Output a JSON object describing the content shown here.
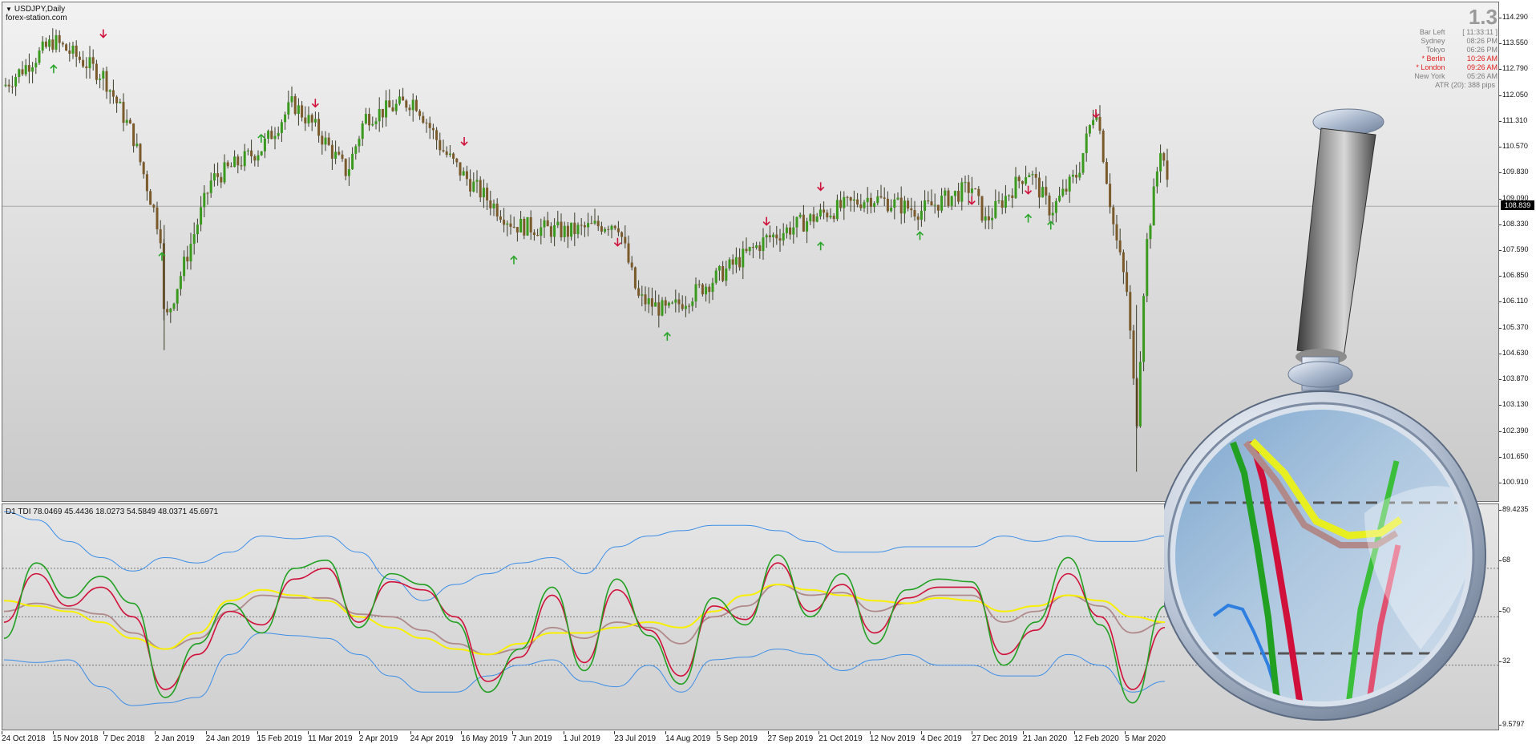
{
  "window": {
    "symbol": "USDJPY,Daily",
    "watermark": "forex-station.com",
    "indicator_title": "D1 TDI 78.0469 45.4436 18.0273 54.5849 48.0371 45.6971"
  },
  "info_panel": {
    "big_value": "1.3",
    "rows": [
      {
        "label": "Bar Left",
        "value": "[ 11:33:11 ]",
        "highlight": false
      },
      {
        "label": "Sydney",
        "value": "08:26 PM",
        "highlight": false
      },
      {
        "label": "Tokyo",
        "value": "06:26 PM",
        "highlight": false
      },
      {
        "label": "* Berlin",
        "value": "10:26 AM",
        "highlight": true
      },
      {
        "label": "* London",
        "value": "09:26 AM",
        "highlight": true
      },
      {
        "label": "New York",
        "value": "05:26 AM",
        "highlight": false
      },
      {
        "label": "ATR (20): 388 pips",
        "value": "",
        "highlight": false
      }
    ]
  },
  "price_axis": {
    "ticks": [
      "114.290",
      "113.550",
      "112.790",
      "112.050",
      "111.310",
      "110.570",
      "109.830",
      "109.090",
      "108.330",
      "107.590",
      "106.850",
      "106.110",
      "105.370",
      "104.630",
      "103.870",
      "103.130",
      "102.390",
      "101.650",
      "100.910"
    ],
    "current_price": "108.839",
    "current_value": 108.839
  },
  "indicator_axis": {
    "ticks": [
      "89.4235",
      "68",
      "50",
      "32",
      "9.5797"
    ]
  },
  "time_axis": {
    "labels": [
      "24 Oct 2018",
      "15 Nov 2018",
      "7 Dec 2018",
      "2 Jan 2019",
      "24 Jan 2019",
      "15 Feb 2019",
      "11 Mar 2019",
      "2 Apr 2019",
      "24 Apr 2019",
      "16 May 2019",
      "7 Jun 2019",
      "1 Jul 2019",
      "23 Jul 2019",
      "14 Aug 2019",
      "5 Sep 2019",
      "27 Sep 2019",
      "21 Oct 2019",
      "12 Nov 2019",
      "4 Dec 2019",
      "27 Dec 2019",
      "21 Jan 2020",
      "12 Feb 2020",
      "5 Mar 2020"
    ]
  },
  "colors": {
    "bull": "#3a9a1e",
    "bear": "#7a5a2a",
    "up_arrow": "#2aa52a",
    "down_arrow": "#d0103a",
    "rsi_green": "#22a022",
    "signal_red": "#d0103a",
    "market_base": "#f7f000",
    "mid_band": "#b08a8a",
    "vol_band": "#3d8ee8"
  },
  "chart_data": [
    {
      "type": "candlestick",
      "symbol": "USDJPY",
      "timeframe": "Daily",
      "ylim": [
        100.91,
        114.29
      ],
      "close_path": [
        [
          "24 Oct 2018",
          112.3
        ],
        [
          "15 Nov 2018",
          113.6
        ],
        [
          "7 Dec 2018",
          112.6
        ],
        [
          "20 Dec 2018",
          110.9
        ],
        [
          "2 Jan 2019",
          107.9
        ],
        [
          "3 Jan 2019",
          105.4
        ],
        [
          "24 Jan 2019",
          109.6
        ],
        [
          "15 Feb 2019",
          110.5
        ],
        [
          "1 Mar 2019",
          111.8
        ],
        [
          "11 Mar 2019",
          111.1
        ],
        [
          "25 Mar 2019",
          109.8
        ],
        [
          "2 Apr 2019",
          111.4
        ],
        [
          "24 Apr 2019",
          111.9
        ],
        [
          "6 May 2019",
          110.5
        ],
        [
          "16 May 2019",
          109.7
        ],
        [
          "7 Jun 2019",
          108.3
        ],
        [
          "1 Jul 2019",
          108.1
        ],
        [
          "23 Jul 2019",
          108.4
        ],
        [
          "1 Aug 2019",
          106.2
        ],
        [
          "14 Aug 2019",
          105.8
        ],
        [
          "5 Sep 2019",
          106.8
        ],
        [
          "27 Sep 2019",
          107.9
        ],
        [
          "21 Oct 2019",
          108.6
        ],
        [
          "12 Nov 2019",
          109.1
        ],
        [
          "4 Dec 2019",
          108.7
        ],
        [
          "27 Dec 2019",
          109.4
        ],
        [
          "2 Jan 2020",
          108.4
        ],
        [
          "21 Jan 2020",
          109.9
        ],
        [
          "31 Jan 2020",
          108.7
        ],
        [
          "12 Feb 2020",
          109.8
        ],
        [
          "20 Feb 2020",
          111.8
        ],
        [
          "28 Feb 2020",
          108.2
        ],
        [
          "5 Mar 2020",
          106.3
        ],
        [
          "9 Mar 2020",
          102.5
        ],
        [
          "13 Mar 2020",
          107.5
        ],
        [
          "20 Mar 2020",
          110.7
        ],
        [
          "24 Mar 2020",
          108.8
        ]
      ],
      "signals_up": [
        [
          "15 Nov 2018",
          112.9
        ],
        [
          "2 Jan 2019",
          107.5
        ],
        [
          "15 Feb 2019",
          110.9
        ],
        [
          "7 Jun 2019",
          107.4
        ],
        [
          "14 Aug 2019",
          105.2
        ],
        [
          "21 Oct 2019",
          107.8
        ],
        [
          "4 Dec 2019",
          108.1
        ],
        [
          "21 Jan 2020",
          108.6
        ],
        [
          "31 Jan 2020",
          108.4
        ]
      ],
      "signals_down": [
        [
          "7 Dec 2018",
          113.7
        ],
        [
          "11 Mar 2019",
          111.7
        ],
        [
          "16 May 2019",
          110.6
        ],
        [
          "23 Jul 2019",
          107.7
        ],
        [
          "27 Sep 2019",
          108.3
        ],
        [
          "21 Oct 2019",
          109.3
        ],
        [
          "27 Dec 2019",
          108.9
        ],
        [
          "21 Jan 2020",
          109.2
        ],
        [
          "20 Feb 2020",
          111.4
        ]
      ]
    },
    {
      "type": "line",
      "title": "D1 TDI",
      "ylim": [
        9.5797,
        89.4235
      ],
      "levels": [
        68,
        50,
        32
      ],
      "series": [
        {
          "name": "RSI price line",
          "color": "#22a022",
          "values": [
            42,
            70,
            57,
            65,
            55,
            20,
            40,
            55,
            44,
            68,
            71,
            46,
            66,
            62,
            48,
            22,
            38,
            61,
            30,
            64,
            43,
            25,
            57,
            47,
            73,
            50,
            66,
            40,
            60,
            64,
            63,
            32,
            48,
            72,
            47,
            18,
            54
          ]
        },
        {
          "name": "Trade signal line",
          "color": "#d0103a",
          "values": [
            48,
            66,
            54,
            61,
            50,
            23,
            36,
            52,
            47,
            64,
            68,
            48,
            63,
            60,
            50,
            26,
            35,
            58,
            33,
            60,
            45,
            28,
            54,
            49,
            70,
            52,
            62,
            44,
            57,
            61,
            61,
            36,
            45,
            66,
            50,
            23,
            46
          ]
        },
        {
          "name": "Market base line",
          "color": "#f7f000",
          "values": [
            56,
            54,
            52,
            48,
            42,
            38,
            44,
            56,
            60,
            58,
            56,
            50,
            46,
            42,
            38,
            36,
            40,
            44,
            44,
            46,
            48,
            46,
            52,
            58,
            62,
            60,
            58,
            56,
            55,
            57,
            56,
            52,
            54,
            58,
            56,
            50,
            48
          ]
        },
        {
          "name": "Middle band",
          "color": "#b08a8a",
          "values": [
            52,
            55,
            53,
            51,
            44,
            38,
            42,
            52,
            58,
            57,
            57,
            51,
            50,
            45,
            40,
            36,
            38,
            46,
            42,
            48,
            46,
            40,
            50,
            54,
            62,
            58,
            59,
            52,
            55,
            58,
            58,
            48,
            52,
            58,
            54,
            44,
            48
          ]
        },
        {
          "name": "Upper band",
          "color": "#3d8ee8",
          "values": [
            89,
            86,
            78,
            72,
            67,
            72,
            70,
            74,
            80,
            79,
            80,
            74,
            64,
            56,
            62,
            66,
            70,
            72,
            66,
            76,
            80,
            82,
            84,
            84,
            82,
            78,
            74,
            74,
            76,
            76,
            76,
            80,
            78,
            80,
            78,
            78,
            80
          ]
        },
        {
          "name": "Lower band",
          "color": "#3d8ee8",
          "values": [
            34,
            33,
            34,
            24,
            17,
            18,
            20,
            36,
            44,
            43,
            42,
            36,
            28,
            22,
            22,
            28,
            32,
            34,
            26,
            24,
            32,
            22,
            34,
            35,
            38,
            36,
            30,
            34,
            36,
            32,
            32,
            28,
            28,
            36,
            32,
            22,
            26
          ]
        }
      ]
    }
  ]
}
